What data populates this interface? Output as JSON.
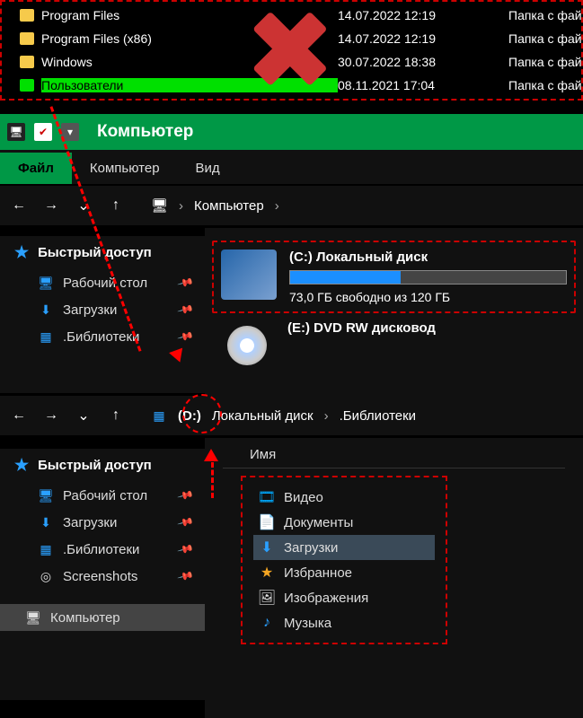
{
  "top_list": {
    "rows": [
      {
        "name": "Program Files",
        "date": "14.07.2022 12:19",
        "type": "Папка с файлам"
      },
      {
        "name": "Program Files (x86)",
        "date": "14.07.2022 12:19",
        "type": "Папка с файлам"
      },
      {
        "name": "Windows",
        "date": "30.07.2022 18:38",
        "type": "Папка с файлам"
      },
      {
        "name": "Пользователи",
        "date": "08.11.2021 17:04",
        "type": "Папка с файлам"
      }
    ],
    "selected_index": 3
  },
  "title": "Компьютер",
  "tabs": {
    "file": "Файл",
    "computer": "Компьютер",
    "view": "Вид"
  },
  "crumb1": {
    "root": "Компьютер"
  },
  "quick_access": "Быстрый доступ",
  "side1": {
    "items": [
      {
        "label": "Рабочий стол"
      },
      {
        "label": "Загрузки"
      },
      {
        "label": ".Библиотеки"
      }
    ]
  },
  "drives": {
    "c": {
      "title": "(C:) Локальный диск",
      "free_text": "73,0 ГБ свободно из 120 ГБ",
      "fill_pct": 40
    },
    "dvd": {
      "title": "(E:) DVD RW дисковод"
    }
  },
  "crumb2": {
    "d": "(D:)",
    "path1": "Локальный диск",
    "path2": ".Библиотеки"
  },
  "side2": {
    "items": [
      {
        "label": "Рабочий стол"
      },
      {
        "label": "Загрузки"
      },
      {
        "label": ".Библиотеки"
      },
      {
        "label": "Screenshots"
      }
    ],
    "computer": "Компьютер"
  },
  "main2": {
    "header": "Имя",
    "items": [
      {
        "label": "Видео"
      },
      {
        "label": "Документы"
      },
      {
        "label": "Загрузки"
      },
      {
        "label": "Избранное"
      },
      {
        "label": "Изображения"
      },
      {
        "label": "Музыка"
      }
    ],
    "selected_index": 2
  }
}
